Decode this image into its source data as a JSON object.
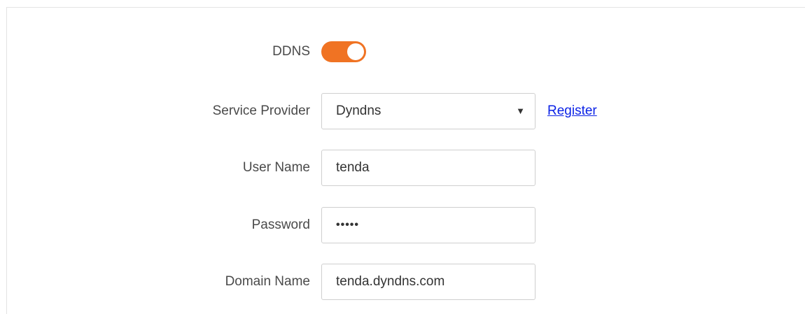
{
  "ddns": {
    "label": "DDNS",
    "enabled": true,
    "toggle_color": "#f07323"
  },
  "service_provider": {
    "label": "Service Provider",
    "selected": "Dyndns",
    "arrow_icon": "triangle-down-icon",
    "register_link": "Register"
  },
  "user_name": {
    "label": "User Name",
    "value": "tenda"
  },
  "password": {
    "label": "Password",
    "masked_value": "•••••"
  },
  "domain_name": {
    "label": "Domain Name",
    "value": "tenda.dyndns.com"
  },
  "colors": {
    "accent": "#f07323",
    "link": "#0b22e6",
    "label_text": "#4a4a4a",
    "border": "#cfcfcf"
  }
}
